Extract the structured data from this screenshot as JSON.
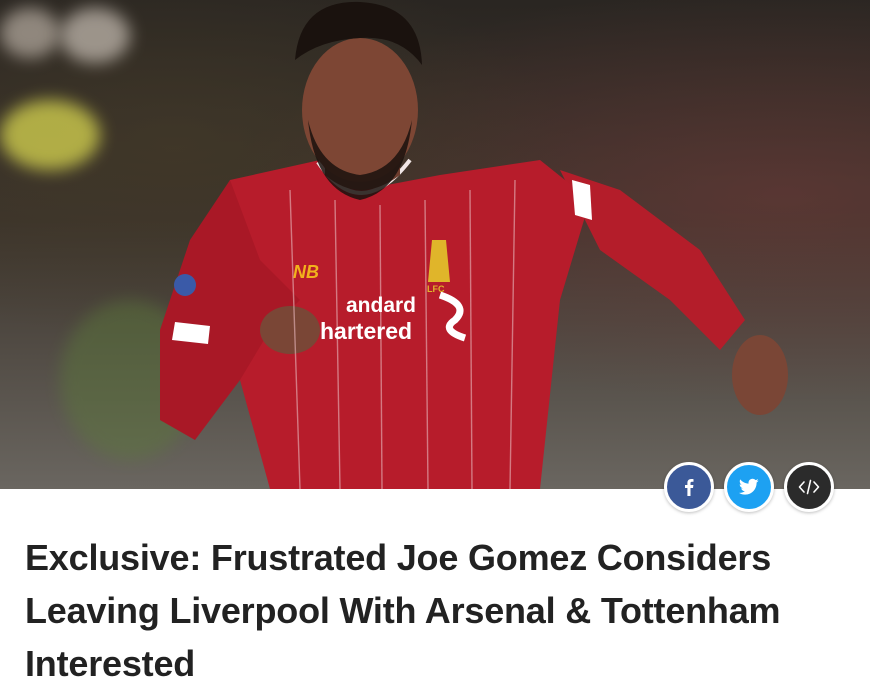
{
  "article": {
    "headline": "Exclusive: Frustrated Joe Gomez Considers Leaving Liverpool With Arsenal & Tottenham Interested"
  },
  "hero_image": {
    "sponsor_line1": "andard",
    "sponsor_line2": "hartered",
    "kit_brand": "NB",
    "crest_text": "LFC"
  },
  "share": {
    "buttons": [
      {
        "name": "facebook",
        "icon": "facebook-icon",
        "color": "#3b5998"
      },
      {
        "name": "twitter",
        "icon": "twitter-icon",
        "color": "#1da1f2"
      },
      {
        "name": "embed",
        "icon": "code-icon",
        "color": "#2b2b2b"
      }
    ]
  }
}
